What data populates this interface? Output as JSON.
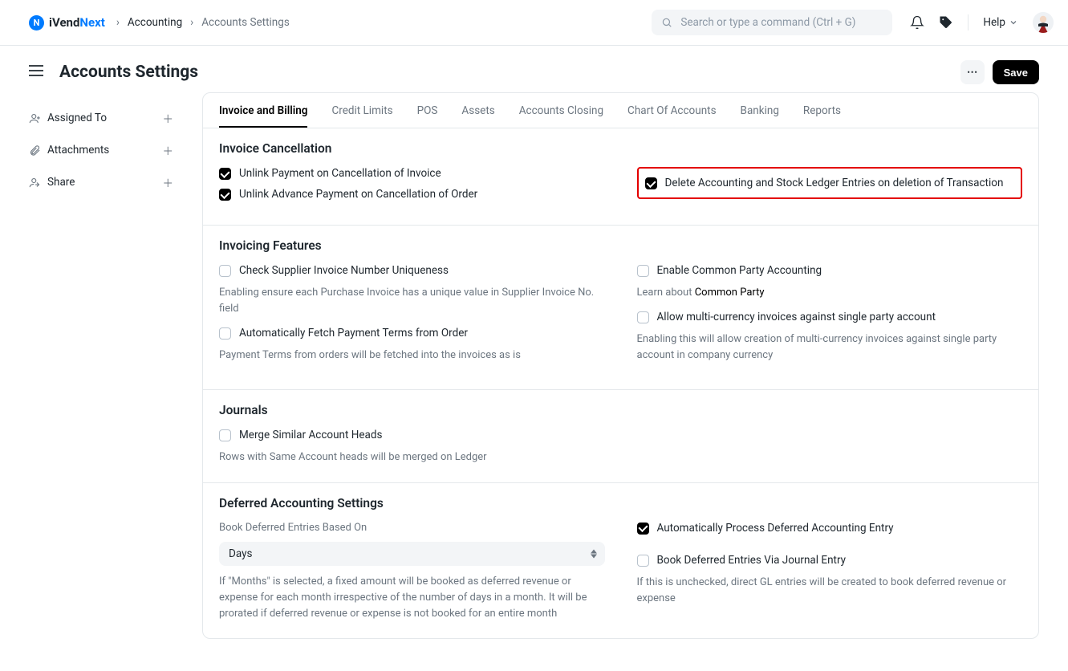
{
  "header": {
    "logo_a": "iVend",
    "logo_b": "Next",
    "breadcrumb": [
      "Accounting",
      "Accounts Settings"
    ],
    "search_placeholder": "Search or type a command (Ctrl + G)",
    "help_label": "Help"
  },
  "page": {
    "title": "Accounts Settings",
    "menu_icon": "⋯",
    "save_label": "Save"
  },
  "sidebar": {
    "items": [
      {
        "label": "Assigned To",
        "icon": "user"
      },
      {
        "label": "Attachments",
        "icon": "clip"
      },
      {
        "label": "Share",
        "icon": "share"
      }
    ]
  },
  "tabs": [
    "Invoice and Billing",
    "Credit Limits",
    "POS",
    "Assets",
    "Accounts Closing",
    "Chart Of Accounts",
    "Banking",
    "Reports"
  ],
  "sections": {
    "invoice_cancellation": {
      "title": "Invoice Cancellation",
      "left": [
        {
          "label": "Unlink Payment on Cancellation of Invoice",
          "checked": true
        },
        {
          "label": "Unlink Advance Payment on Cancellation of Order",
          "checked": true
        }
      ],
      "right": [
        {
          "label": "Delete Accounting and Stock Ledger Entries on deletion of Transaction",
          "checked": true,
          "highlighted": true
        }
      ]
    },
    "invoicing_features": {
      "title": "Invoicing Features",
      "left": [
        {
          "label": "Check Supplier Invoice Number Uniqueness",
          "checked": false,
          "help": "Enabling ensure each Purchase Invoice has a unique value in Supplier Invoice No. field"
        },
        {
          "label": "Automatically Fetch Payment Terms from Order",
          "checked": false,
          "help": "Payment Terms from orders will be fetched into the invoices as is"
        }
      ],
      "right": [
        {
          "label": "Enable Common Party Accounting",
          "checked": false,
          "help_prefix": "Learn about ",
          "help_strong": "Common Party"
        },
        {
          "label": "Allow multi-currency invoices against single party account",
          "checked": false,
          "help": "Enabling this will allow creation of multi-currency invoices against single party account in company currency"
        }
      ]
    },
    "journals": {
      "title": "Journals",
      "left": [
        {
          "label": "Merge Similar Account Heads",
          "checked": false,
          "help": "Rows with Same Account heads will be merged on Ledger"
        }
      ]
    },
    "deferred": {
      "title": "Deferred Accounting Settings",
      "left": {
        "field_label": "Book Deferred Entries Based On",
        "value": "Days",
        "help": "If \"Months\" is selected, a fixed amount will be booked as deferred revenue or expense for each month irrespective of the number of days in a month. It will be prorated if deferred revenue or expense is not booked for an entire month"
      },
      "right": [
        {
          "label": "Automatically Process Deferred Accounting Entry",
          "checked": true
        },
        {
          "label": "Book Deferred Entries Via Journal Entry",
          "checked": false,
          "help": "If this is unchecked, direct GL entries will be created to book deferred revenue or expense"
        }
      ]
    }
  }
}
